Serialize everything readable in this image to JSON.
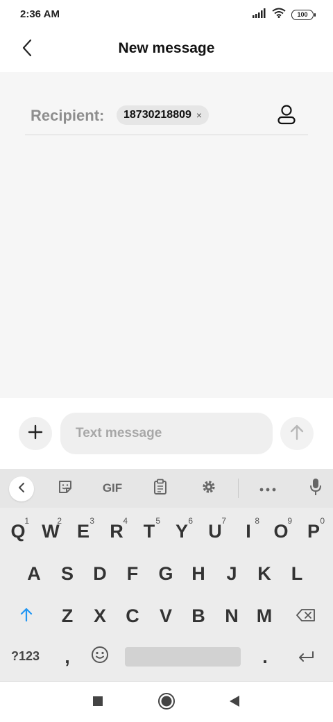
{
  "status_bar": {
    "time": "2:36 AM",
    "battery": "100",
    "icons": [
      "signal-icon",
      "wifi-icon",
      "battery-icon"
    ]
  },
  "header": {
    "title": "New message",
    "back_icon": "chevron-left-icon"
  },
  "recipient": {
    "label": "Recipient:",
    "chip_value": "18730218809",
    "chip_remove": "×",
    "contact_icon": "person-icon"
  },
  "composer": {
    "placeholder": "Text message",
    "attach_icon": "plus-icon",
    "send_icon": "arrow-up-icon"
  },
  "keyboard": {
    "toolbar": {
      "gif_label": "GIF",
      "icons": [
        "chevron-left-icon",
        "sticker-icon",
        "clipboard-icon",
        "gear-icon",
        "more-icon",
        "mic-icon"
      ]
    },
    "row1": [
      "Q",
      "W",
      "E",
      "R",
      "T",
      "Y",
      "U",
      "I",
      "O",
      "P"
    ],
    "row1_hints": [
      "1",
      "2",
      "3",
      "4",
      "5",
      "6",
      "7",
      "8",
      "9",
      "0"
    ],
    "row2": [
      "A",
      "S",
      "D",
      "F",
      "G",
      "H",
      "J",
      "K",
      "L"
    ],
    "row3": [
      "Z",
      "X",
      "C",
      "V",
      "B",
      "N",
      "M"
    ],
    "symbols_label": "?123",
    "comma": ",",
    "period": "."
  },
  "colors": {
    "accent": "#2196f3",
    "content_bg": "#f6f6f6",
    "keyboard_bg": "#ececec"
  },
  "nav_bar": {
    "icons": [
      "square-icon",
      "home-circle-icon",
      "back-triangle-icon"
    ]
  }
}
